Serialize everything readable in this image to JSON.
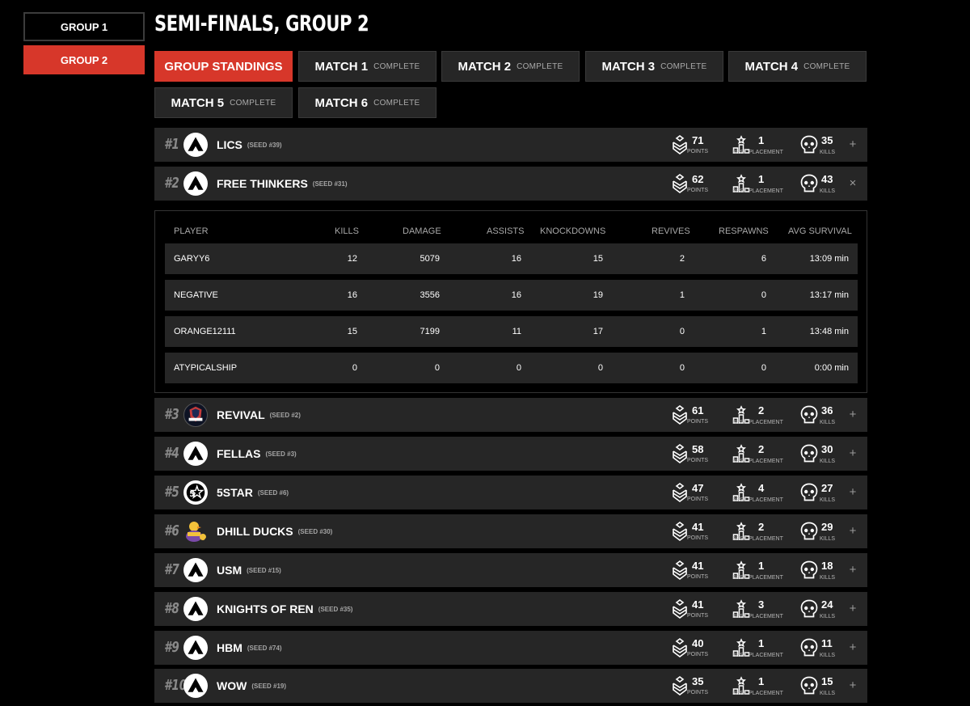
{
  "sidebar": {
    "groups": [
      {
        "label": "GROUP 1"
      },
      {
        "label": "GROUP 2"
      }
    ]
  },
  "page_title": "SEMI-FINALS, GROUP 2",
  "tabs": [
    {
      "label": "GROUP STANDINGS",
      "status": ""
    },
    {
      "label": "MATCH 1",
      "status": "COMPLETE"
    },
    {
      "label": "MATCH 2",
      "status": "COMPLETE"
    },
    {
      "label": "MATCH 3",
      "status": "COMPLETE"
    },
    {
      "label": "MATCH 4",
      "status": "COMPLETE"
    },
    {
      "label": "MATCH 5",
      "status": "COMPLETE"
    },
    {
      "label": "MATCH 6",
      "status": "COMPLETE"
    }
  ],
  "stat_labels": {
    "points": "POINTS",
    "best_placement": "BEST PLACEMENT",
    "kills": "KILLS"
  },
  "teams": [
    {
      "rank": "#1",
      "name": "LICS",
      "seed": "(SEED #39)",
      "points": "71",
      "best": "1",
      "kills": "35",
      "toggle": "+"
    },
    {
      "rank": "#2",
      "name": "FREE THINKERS",
      "seed": "(SEED #31)",
      "points": "62",
      "best": "1",
      "kills": "43",
      "toggle": "×"
    },
    {
      "rank": "#3",
      "name": "REVIVAL",
      "seed": "(SEED #2)",
      "points": "61",
      "best": "2",
      "kills": "36",
      "toggle": "+"
    },
    {
      "rank": "#4",
      "name": "FELLAS",
      "seed": "(SEED #3)",
      "points": "58",
      "best": "2",
      "kills": "30",
      "toggle": "+"
    },
    {
      "rank": "#5",
      "name": "5STAR",
      "seed": "(SEED #6)",
      "points": "47",
      "best": "4",
      "kills": "27",
      "toggle": "+"
    },
    {
      "rank": "#6",
      "name": "DHILL DUCKS",
      "seed": "(SEED #30)",
      "points": "41",
      "best": "2",
      "kills": "29",
      "toggle": "+"
    },
    {
      "rank": "#7",
      "name": "USM",
      "seed": "(SEED #15)",
      "points": "41",
      "best": "1",
      "kills": "18",
      "toggle": "+"
    },
    {
      "rank": "#8",
      "name": "KNIGHTS OF REN",
      "seed": "(SEED #35)",
      "points": "41",
      "best": "3",
      "kills": "24",
      "toggle": "+"
    },
    {
      "rank": "#9",
      "name": "HBM",
      "seed": "(SEED #74)",
      "points": "40",
      "best": "1",
      "kills": "11",
      "toggle": "+"
    },
    {
      "rank": "#10",
      "name": "WOW",
      "seed": "(SEED #19)",
      "points": "35",
      "best": "1",
      "kills": "15",
      "toggle": "+"
    }
  ],
  "player_table": {
    "headers": [
      "PLAYER",
      "KILLS",
      "DAMAGE",
      "ASSISTS",
      "KNOCKDOWNS",
      "REVIVES",
      "RESPAWNS",
      "AVG SURVIVAL"
    ],
    "rows": [
      [
        "GARYY6",
        "12",
        "5079",
        "16",
        "15",
        "2",
        "6",
        "13:09 min"
      ],
      [
        "NEGATIVE",
        "16",
        "3556",
        "16",
        "19",
        "1",
        "0",
        "13:17 min"
      ],
      [
        "ORANGE12111",
        "15",
        "7199",
        "11",
        "17",
        "0",
        "1",
        "13:48 min"
      ],
      [
        "ATYPICALSHIP",
        "0",
        "0",
        "0",
        "0",
        "0",
        "0",
        "0:00 min"
      ]
    ]
  },
  "icons": {
    "points": "chevron-rank-icon",
    "best_placement": "podium-icon",
    "kills": "skull-icon",
    "team_logo": "apex-logo-icon"
  },
  "colors": {
    "accent": "#d7372a",
    "row_bg": "#262626",
    "background": "#000000"
  }
}
